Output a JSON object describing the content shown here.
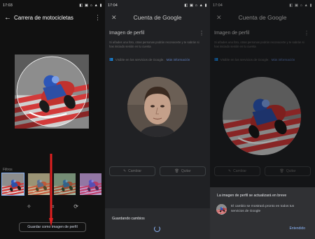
{
  "screen1": {
    "status_time": "17:03",
    "status_icons": "◧ ▣ ⌂ ▲ ▮",
    "title": "Carrera de motocicletas",
    "filters_label": "Filtros",
    "save_button": "Guardar como imagen de perfil"
  },
  "screen2": {
    "status_time": "17:04",
    "status_icons": "◧ ▣ ⌂ ▲ ▮",
    "title": "Cuenta de Google",
    "section_title": "Imagen de perfil",
    "info": "Si añades una foto, otras personas podrán reconocerte y te sabrán si has iniciado sesión en tu cuenta",
    "visibility": "Visible en los servicios de Google.",
    "visibility_link": "Más información",
    "change_button": "Cambiar",
    "remove_button": "Quitar",
    "saving_text": "Guardando cambios"
  },
  "screen3": {
    "status_time": "17:04",
    "status_icons": "◧ ▣ ⌂ ▲ ▮",
    "title": "Cuenta de Google",
    "section_title": "Imagen de perfil",
    "info": "Si añades una foto, otras personas podrán reconocerte y te sabrán si has iniciado sesión en tu cuenta",
    "visibility": "Visible en los servicios de Google.",
    "visibility_link": "Más información",
    "change_button": "Cambiar",
    "remove_button": "Quitar",
    "dialog_title": "La imagen de perfil se actualizará en breve",
    "dialog_text": "El cambio se mostrará pronto en todos tus servicios de Google",
    "dialog_ok": "Entendido"
  },
  "colors": {
    "accent": "#8ab4f8",
    "arrow": "#e02020",
    "dark_bg": "#202124"
  }
}
